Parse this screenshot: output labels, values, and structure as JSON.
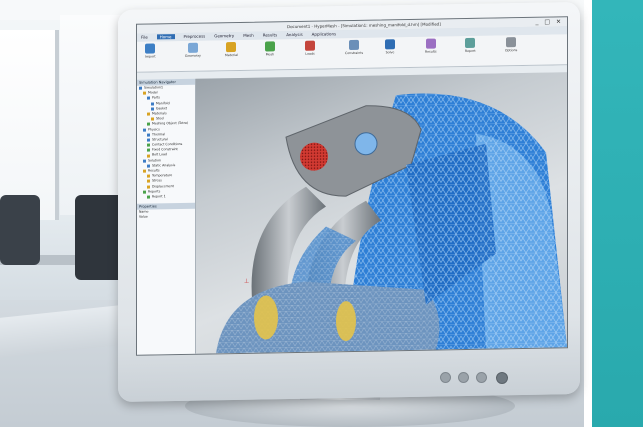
{
  "window": {
    "title": "Document1 - HyperMesh - [Simulation1: meshing_manifold_d.hm] [Modified]",
    "controls": "_ □ ✕"
  },
  "menu": {
    "items": [
      "File",
      "Home",
      "Preprocess",
      "Geometry",
      "Mesh",
      "Results",
      "Analysis",
      "Applications"
    ],
    "active_index": 1
  },
  "ribbon": {
    "groups": [
      {
        "label": "Import",
        "icon": "import-icon",
        "color": "#3d7fc5"
      },
      {
        "label": "Geometry",
        "icon": "geometry-icon",
        "color": "#7aa7d6"
      },
      {
        "label": "Material",
        "icon": "material-icon",
        "color": "#d8a323"
      },
      {
        "label": "Mesh",
        "icon": "mesh-icon",
        "color": "#4aa24a"
      },
      {
        "label": "Loads",
        "icon": "loads-icon",
        "color": "#c4453c"
      },
      {
        "label": "Constraints",
        "icon": "constraints-icon",
        "color": "#6b8fb8"
      },
      {
        "label": "Solve",
        "icon": "solve-icon",
        "color": "#2f6db3"
      },
      {
        "label": "Results",
        "icon": "results-icon",
        "color": "#9b6fc2"
      },
      {
        "label": "Report",
        "icon": "report-icon",
        "color": "#5d9f9b"
      },
      {
        "label": "Options",
        "icon": "options-icon",
        "color": "#8a9199"
      }
    ]
  },
  "tree": {
    "header": "Simulation Navigator",
    "items": [
      {
        "label": "Simulation1",
        "indent": 0,
        "color": "b"
      },
      {
        "label": "Model",
        "indent": 1,
        "color": "y"
      },
      {
        "label": "Parts",
        "indent": 2,
        "color": "b"
      },
      {
        "label": "Manifold",
        "indent": 3,
        "color": "b"
      },
      {
        "label": "Gasket",
        "indent": 3,
        "color": "b"
      },
      {
        "label": "Materials",
        "indent": 2,
        "color": "y"
      },
      {
        "label": "Steel",
        "indent": 3,
        "color": "y"
      },
      {
        "label": "Meshing Object (Tetra)",
        "indent": 2,
        "color": "g"
      },
      {
        "label": "Physics",
        "indent": 1,
        "color": "b"
      },
      {
        "label": "Thermal",
        "indent": 2,
        "color": "b"
      },
      {
        "label": "Structural",
        "indent": 2,
        "color": "b"
      },
      {
        "label": "Contact Conditions",
        "indent": 2,
        "color": "g"
      },
      {
        "label": "Fixed Constraint",
        "indent": 2,
        "color": "g"
      },
      {
        "label": "Bolt Load",
        "indent": 2,
        "color": "y"
      },
      {
        "label": "Solution",
        "indent": 1,
        "color": "b"
      },
      {
        "label": "Static Analysis",
        "indent": 2,
        "color": "b"
      },
      {
        "label": "Results",
        "indent": 1,
        "color": "y"
      },
      {
        "label": "Temperature",
        "indent": 2,
        "color": "y"
      },
      {
        "label": "Stress",
        "indent": 2,
        "color": "y"
      },
      {
        "label": "Displacement",
        "indent": 2,
        "color": "y"
      },
      {
        "label": "Reports",
        "indent": 1,
        "color": "g"
      },
      {
        "label": "Report 1",
        "indent": 2,
        "color": "g"
      }
    ]
  },
  "properties": {
    "header": "Properties",
    "rows": [
      "Name",
      "Value"
    ]
  },
  "colors": {
    "mesh_blue": "#2e7fd6",
    "mesh_light": "#7fb6ea",
    "part_gray": "#8e9398",
    "accent_teal": "#2faeb2",
    "hot_red": "#d23a32"
  }
}
